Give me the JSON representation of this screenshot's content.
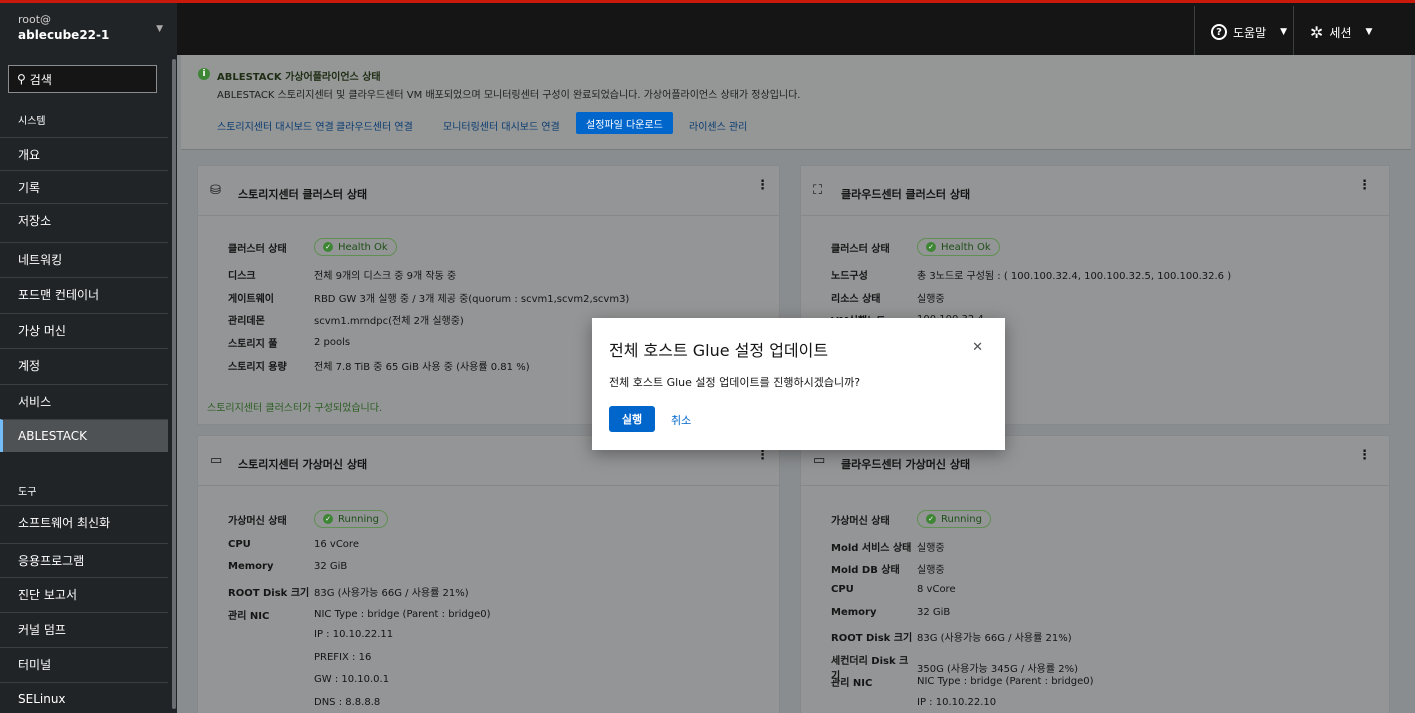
{
  "header": {
    "user": "root@",
    "host": "ablecube22-1",
    "help_label": "도움말",
    "session_label": "세션"
  },
  "sidebar": {
    "search_label": "검색",
    "system_label": "시스템",
    "tools_label": "도구",
    "items": [
      {
        "label": "개요"
      },
      {
        "label": "기록"
      },
      {
        "label": "저장소"
      },
      {
        "label": "네트워킹"
      },
      {
        "label": "포드맨 컨테이너"
      },
      {
        "label": "가상 머신"
      },
      {
        "label": "계정"
      },
      {
        "label": "서비스"
      },
      {
        "label": "ABLESTACK"
      }
    ],
    "tool_items": [
      {
        "label": "소프트웨어 최신화"
      },
      {
        "label": "응용프로그램"
      },
      {
        "label": "진단 보고서"
      },
      {
        "label": "커널 덤프"
      },
      {
        "label": "터미널"
      },
      {
        "label": "SELinux"
      }
    ],
    "active_item": "ABLESTACK"
  },
  "alert": {
    "title": "ABLESTACK 가상어플라이언스 상태",
    "description": "ABLESTACK 스토리지센터 및 클라우드센터 VM 배포되었으며 모니터링센터 구성이 완료되었습니다. 가상어플라이언스 상태가 정상입니다.",
    "links": [
      "스토리지센터 대시보드 연결",
      "클라우드센터 연결",
      "모니터링센터 대시보드 연결"
    ],
    "primary_button": "설정파일 다운로드",
    "license_link": "라이센스 관리"
  },
  "storage_cluster": {
    "title": "스토리지센터 클러스터 상태",
    "status_label": "클러스터 상태",
    "status_value": "Health Ok",
    "rows": [
      {
        "key": "디스크",
        "value": "전체 9개의 디스크 중 9개 작동 중"
      },
      {
        "key": "게이트웨이",
        "value": "RBD GW 3개 실행 중 / 3개 제공 중(quorum : scvm1,scvm2,scvm3)"
      },
      {
        "key": "관리데몬",
        "value": "scvm1.mrndpc(전체 2개 실행중)"
      },
      {
        "key": "스토리지 풀",
        "value": "2 pools"
      },
      {
        "key": "스토리지 용량",
        "value": "전체 7.8 TiB 중 65 GiB 사용 중 (사용률 0.81 %)"
      }
    ],
    "footer": "스토리지센터 클러스터가 구성되었습니다."
  },
  "cloud_cluster": {
    "title": "클라우드센터 클러스터 상태",
    "status_label": "클러스터 상태",
    "status_value": "Health Ok",
    "rows": [
      {
        "key": "노드구성",
        "value": "총 3노드로 구성됨 : ( 100.100.32.4, 100.100.32.5, 100.100.32.6 )"
      },
      {
        "key": "리소스 상태",
        "value": "실행중"
      },
      {
        "key": "VM실행노드",
        "value": "100.100.32.4"
      }
    ]
  },
  "storage_vm": {
    "title": "스토리지센터 가상머신 상태",
    "status_label": "가상머신 상태",
    "status_value": "Running",
    "rows": [
      {
        "key": "CPU",
        "value": "16 vCore"
      },
      {
        "key": "Memory",
        "value": "32 GiB"
      },
      {
        "key": "ROOT Disk 크기",
        "value": "83G (사용가능 66G / 사용률 21%)"
      },
      {
        "key": "관리 NIC",
        "value": "NIC Type : bridge (Parent : bridge0)"
      },
      {
        "key": "",
        "value": "IP : 10.10.22.11"
      },
      {
        "key": "",
        "value": "PREFIX : 16"
      },
      {
        "key": "",
        "value": "GW : 10.10.0.1"
      },
      {
        "key": "",
        "value": "DNS : 8.8.8.8"
      }
    ]
  },
  "cloud_vm": {
    "title": "클라우드센터 가상머신 상태",
    "status_label": "가상머신 상태",
    "status_value": "Running",
    "rows": [
      {
        "key": "Mold 서비스 상태",
        "value": "실행중"
      },
      {
        "key": "Mold DB 상태",
        "value": "실행중"
      },
      {
        "key": "CPU",
        "value": "8 vCore"
      },
      {
        "key": "Memory",
        "value": "32 GiB"
      },
      {
        "key": "ROOT Disk 크기",
        "value": "83G (사용가능 66G / 사용률 21%)"
      },
      {
        "key": "세컨더리 Disk 크기",
        "value": "350G (사용가능 345G / 사용률 2%)"
      },
      {
        "key": "관리 NIC",
        "value": "NIC Type : bridge (Parent : bridge0)"
      },
      {
        "key": "",
        "value": "IP : 10.10.22.10"
      }
    ]
  },
  "modal": {
    "title": "전체 호스트 Glue 설정 업데이트",
    "message": "전체 호스트 Glue 설정 업데이트를 진행하시겠습니까?",
    "confirm": "실행",
    "cancel": "취소"
  },
  "colors": {
    "accent": "#0066cc",
    "success": "#3e8635",
    "topbar_border": "#c9190b"
  }
}
